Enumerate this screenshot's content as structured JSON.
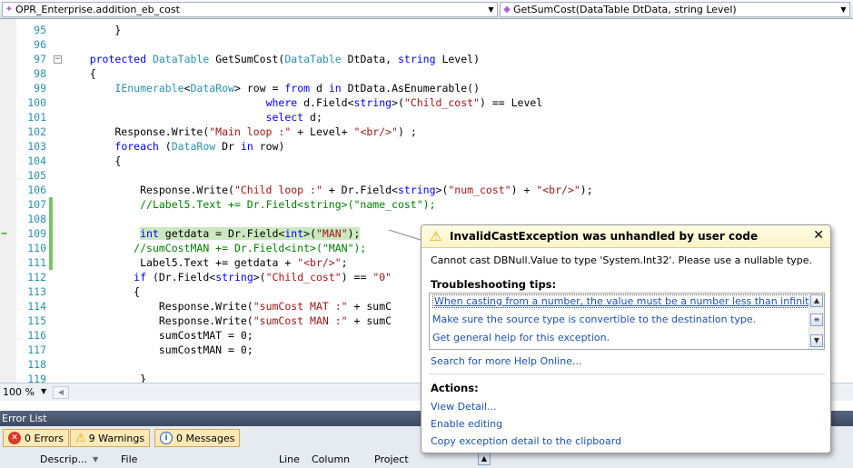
{
  "navbar": {
    "left_combo": "OPR_Enterprise.addition_eb_cost",
    "right_combo": "GetSumCost(DataTable DtData, string Level)"
  },
  "code_lines": [
    {
      "num": "95",
      "html": "        }"
    },
    {
      "num": "96",
      "html": ""
    },
    {
      "num": "97",
      "html": "    <span class=\"kw\">protected</span> <span class=\"ty\">DataTable</span> GetSumCost(<span class=\"ty\">DataTable</span> DtData, <span class=\"kw\">string</span> Level)"
    },
    {
      "num": "98",
      "html": "    {"
    },
    {
      "num": "99",
      "html": "        <span class=\"ty\">IEnumerable</span>&lt;<span class=\"ty\">DataRow</span>&gt; row = <span class=\"kw\">from</span> d <span class=\"kw\">in</span> DtData.AsEnumerable()"
    },
    {
      "num": "100",
      "html": "                                <span class=\"kw\">where</span> d.Field&lt;<span class=\"kw\">string</span>&gt;(<span class=\"st\">\"Child_cost\"</span>) == Level"
    },
    {
      "num": "101",
      "html": "                                <span class=\"kw\">select</span> d;"
    },
    {
      "num": "102",
      "html": "        Response.Write(<span class=\"st\">\"Main loop :\"</span> + Level+ <span class=\"st\">\"&lt;br/&gt;\"</span>) ;"
    },
    {
      "num": "103",
      "html": "        <span class=\"kw\">foreach</span> (<span class=\"ty\">DataRow</span> Dr <span class=\"kw\">in</span> row)"
    },
    {
      "num": "104",
      "html": "        {"
    },
    {
      "num": "105",
      "html": ""
    },
    {
      "num": "106",
      "html": "            Response.Write(<span class=\"st\">\"Child loop :\"</span> + Dr.Field&lt;<span class=\"kw\">string</span>&gt;(<span class=\"st\">\"num_cost\"</span>) + <span class=\"st\">\"&lt;br/&gt;\"</span>);"
    },
    {
      "num": "107",
      "html": "            <span class=\"cm\">//Label5.Text += Dr.Field&lt;string&gt;(\"name_cost\");</span>"
    },
    {
      "num": "108",
      "html": ""
    },
    {
      "num": "109",
      "html": "            <span class=\"hl\"><span class=\"kw\">int</span> getdata = Dr.Field&lt;<span class=\"kw\">int</span>&gt;(<span class=\"st\">\"MAN\"</span>);</span>"
    },
    {
      "num": "110",
      "html": "           <span class=\"cm\">//sumCostMAN += Dr.Field&lt;int&gt;(\"MAN\");</span>"
    },
    {
      "num": "111",
      "html": "            Label5.Text += getdata + <span class=\"st\">\"&lt;br/&gt;\"</span>;"
    },
    {
      "num": "112",
      "html": "           <span class=\"kw\">if</span> (Dr.Field&lt;<span class=\"kw\">string</span>&gt;(<span class=\"st\">\"Child_cost\"</span>) == <span class=\"st\">\"0\"</span>"
    },
    {
      "num": "113",
      "html": "           {"
    },
    {
      "num": "114",
      "html": "               Response.Write(<span class=\"st\">\"sumCost MAT :\"</span> + sumC"
    },
    {
      "num": "115",
      "html": "               Response.Write(<span class=\"st\">\"sumCost MAN :\"</span> + sumC"
    },
    {
      "num": "116",
      "html": "               sumCostMAT = 0;"
    },
    {
      "num": "117",
      "html": "               sumCostMAN = 0;"
    },
    {
      "num": "118",
      "html": ""
    },
    {
      "num": "119",
      "html": "            }"
    }
  ],
  "status": {
    "zoom": "100 %"
  },
  "error_list": {
    "title": "Error List",
    "errors": "0 Errors",
    "warnings": "9 Warnings",
    "messages": "0 Messages",
    "columns": [
      "Descrip...",
      "File",
      "Line",
      "Column",
      "Project"
    ]
  },
  "exception": {
    "title": "InvalidCastException was unhandled by user code",
    "message": "Cannot cast DBNull.Value to type 'System.Int32'. Please use a nullable type.",
    "tips_heading": "Troubleshooting tips:",
    "tips": [
      "When casting from a number, the value must be a number less than infinity.",
      "Make sure the source type is convertible to the destination type.",
      "Get general help for this exception."
    ],
    "search_link": "Search for more Help Online...",
    "actions_heading": "Actions:",
    "actions": [
      "View Detail...",
      "Enable editing",
      "Copy exception detail to the clipboard"
    ]
  }
}
